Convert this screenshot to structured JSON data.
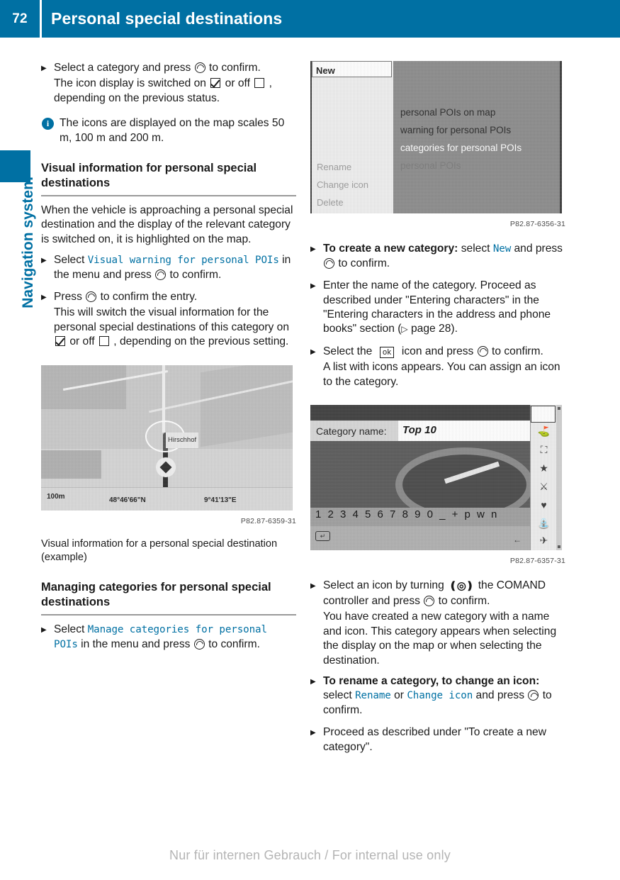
{
  "header": {
    "page_number": "72",
    "title": "Personal special destinations",
    "accent_color": "#0070a3"
  },
  "sidebar": {
    "chapter_label": "Navigation system"
  },
  "footer": {
    "text": "Nur für internen Gebrauch / For internal use only"
  },
  "left_column": {
    "step_select_category": {
      "line1": "Select a category and press",
      "line1_end": "to confirm.",
      "line2_a": "The icon display is switched on",
      "line2_b": "or off",
      "line2_c": ", depending on the previous status."
    },
    "note_map_scales": "The icons are displayed on the map scales 50 m, 100 m and 200 m.",
    "heading_visual_info": "Visual information for personal special destinations",
    "para_when_vehicle": "When the vehicle is approaching a personal special destination and the display of the relevant category is switched on, it is highlighted on the map.",
    "step_select_visual": {
      "prefix": "Select",
      "menu": "Visual warning for personal POIs",
      "mid": "in the menu and press",
      "suffix": "to confirm."
    },
    "step_press_confirm": {
      "prefix": "Press",
      "suffix": "to confirm the entry.",
      "body_a": "This will switch the visual information for the personal special destinations of this category on",
      "body_b": "or off",
      "body_c": ", depending on the previous setting."
    },
    "figure_map": {
      "code": "P82.87-6359-31",
      "caption": "Visual information for a personal special destination (example)",
      "scale": "100m",
      "coord_lat": "48°46'66\"N",
      "coord_lon": "9°41'13\"E",
      "poi_label": "Hirschhof"
    },
    "heading_managing": "Managing categories for personal special destinations",
    "step_manage": {
      "prefix": "Select",
      "menu": "Manage categories for personal POIs",
      "mid": "in the menu and press",
      "suffix": "to confirm."
    }
  },
  "right_column": {
    "figure_menu": {
      "code": "P82.87-6356-31",
      "popup_items": [
        "New",
        "Rename",
        "Change icon",
        "Delete"
      ],
      "list_items": [
        "personal POIs on map",
        "warning for personal POIs",
        "categories for personal POIs",
        "personal POIs"
      ]
    },
    "step_create_category": {
      "lead": "To create a new category:",
      "mid": "select",
      "menu": "New",
      "tail": "and press",
      "suffix": "to confirm."
    },
    "step_enter_name": {
      "text_a": "Enter the name of the category. Proceed as described under \"Entering characters\" in the \"Entering characters in the address and phone books\" section (",
      "page_ref": "page 28",
      "text_b": ")."
    },
    "step_select_ok": {
      "prefix": "Select the",
      "icon": "ok",
      "mid": "icon and press",
      "suffix": "to confirm.",
      "body": "A list with icons appears. You can assign an icon to the category."
    },
    "figure_name_entry": {
      "code": "P82.87-6357-31",
      "field_label": "Category name:",
      "field_value": "Top 10",
      "keyboard_row": "1 2 3 4 5 6 7 8 9 0 _     + p w n"
    },
    "step_select_icon": {
      "prefix": "Select an icon by turning",
      "mid": "the COMAND controller and press",
      "suffix": "to confirm.",
      "body": "You have created a new category with a name and icon. This category appears when selecting the display on the map or when selecting the destination."
    },
    "step_rename": {
      "lead": "To rename a category, to change an icon:",
      "mid": "select",
      "menu_a": "Rename",
      "or": "or",
      "menu_b": "Change icon",
      "tail": "and press",
      "suffix": "to confirm."
    },
    "step_proceed": "Proceed as described under \"To create a new category\"."
  }
}
